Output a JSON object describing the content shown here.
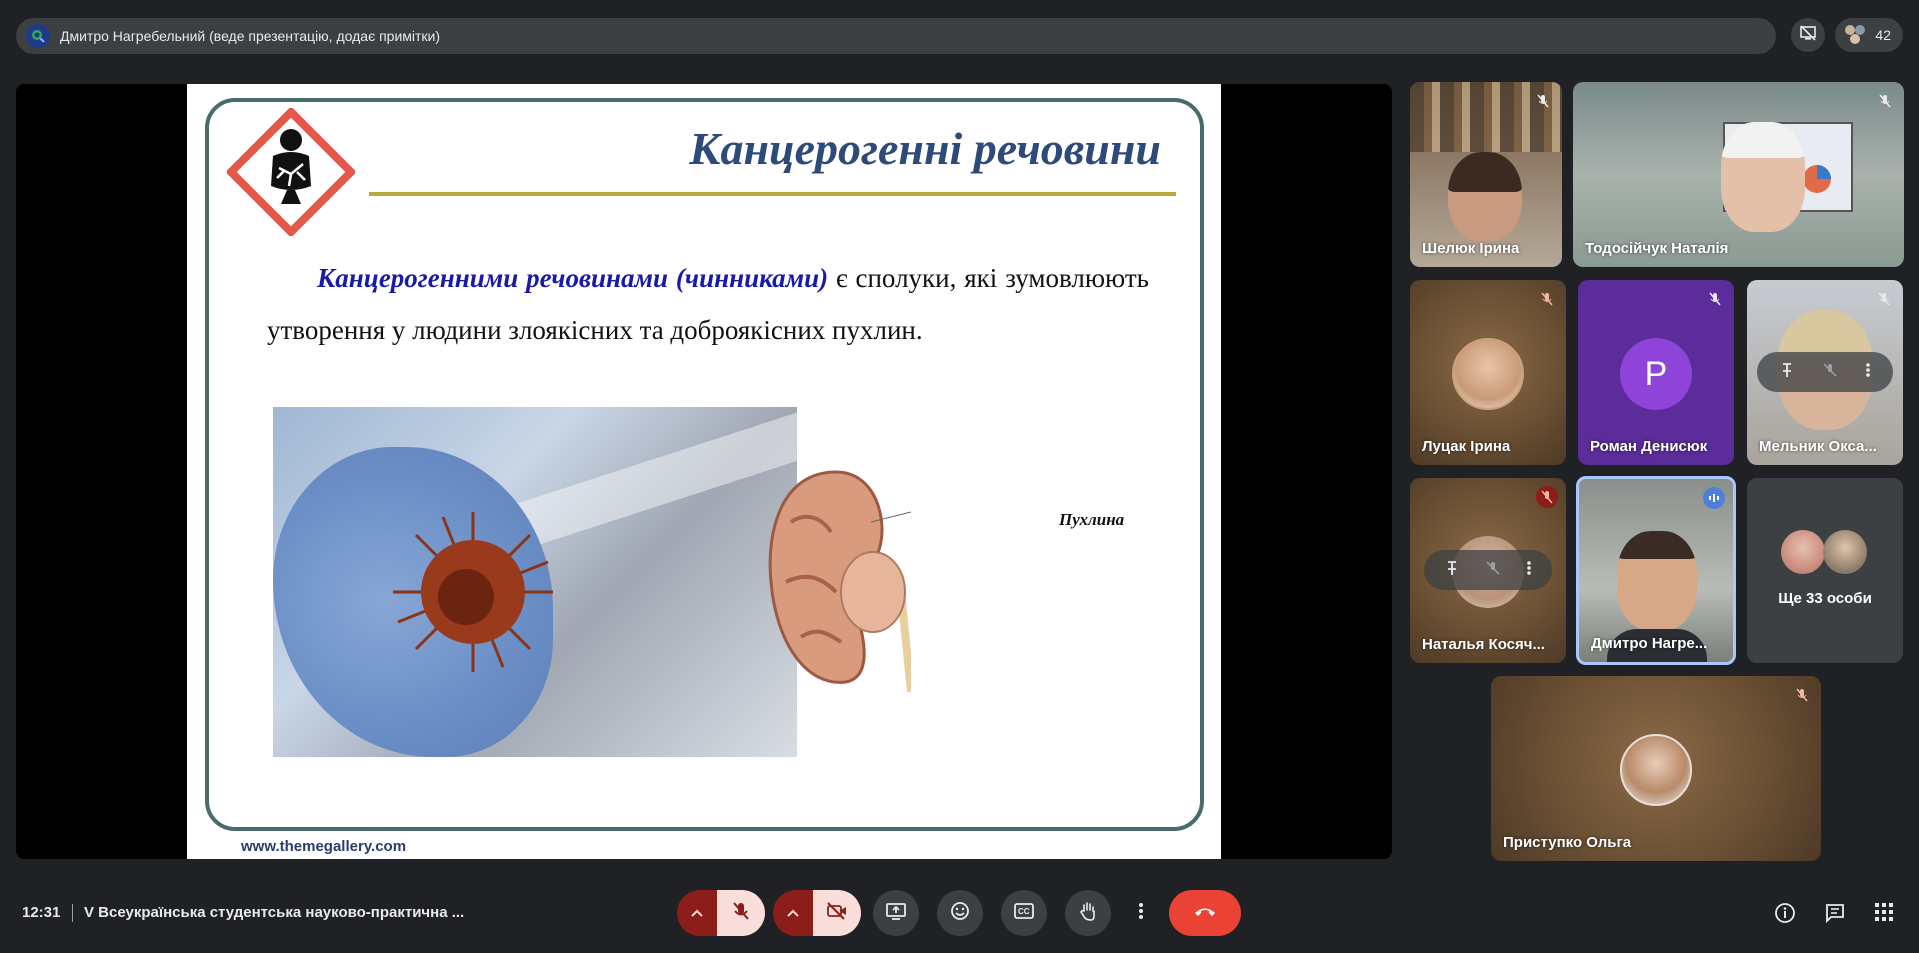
{
  "topbar": {
    "presenter_text": "Дмитро Нагребельний (веде презентацію, додає примітки)",
    "participant_count": "42"
  },
  "slide": {
    "title": "Канцерогенні речовини",
    "body_emphasis": "Канцерогенними речовинами (чинниками)",
    "body_rest": " є сполуки, які зумовлюють утворення у людини злоякісних та доброякісних пухлин.",
    "kidney_label": "Пухлина",
    "footer": "www.themegallery.com"
  },
  "participants": {
    "p1": "Шелюк Ірина",
    "p2": "Тодосійчук Наталія",
    "p3": "Луцак Ірина",
    "p4": "Роман Денисюк",
    "p4_initial": "P",
    "p5": "Мельник Окса...",
    "p6": "Наталья Косяч...",
    "p7": "Дмитро Нагре...",
    "others": "Ще 33 особи",
    "p8": "Приступко Ольга"
  },
  "bottombar": {
    "time": "12:31",
    "meeting_title": "V Всеукраїнська студентська науково-практична ..."
  },
  "colors": {
    "end_call": "#ea4335",
    "mic_off_bg": "#f9dedc",
    "split_dark": "#8c1d18",
    "speaking_border": "#a8c7fa",
    "avatar_purple": "#8e44d9"
  }
}
